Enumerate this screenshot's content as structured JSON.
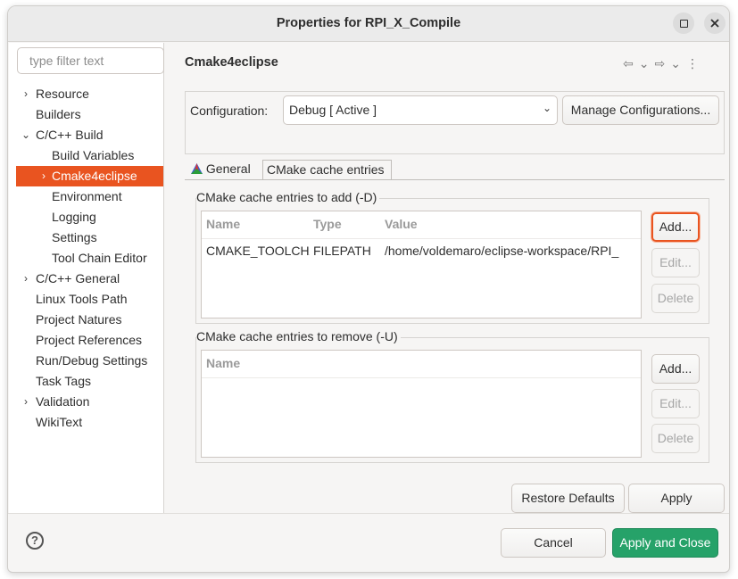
{
  "window": {
    "title": "Properties for RPI_X_Compile"
  },
  "filter": {
    "placeholder": "type filter text"
  },
  "tree": {
    "resource": "Resource",
    "builders": "Builders",
    "cpp_build": "C/C++ Build",
    "build_variables": "Build Variables",
    "cmake4eclipse": "Cmake4eclipse",
    "environment": "Environment",
    "logging": "Logging",
    "settings": "Settings",
    "tool_chain_editor": "Tool Chain Editor",
    "cpp_general": "C/C++ General",
    "linux_tools_path": "Linux Tools Path",
    "project_natures": "Project Natures",
    "project_references": "Project References",
    "run_debug_settings": "Run/Debug Settings",
    "task_tags": "Task Tags",
    "validation": "Validation",
    "wikitext": "WikiText"
  },
  "page": {
    "title": "Cmake4eclipse"
  },
  "configuration": {
    "label": "Configuration:",
    "selected": "Debug  [ Active ]",
    "manage_button": "Manage Configurations..."
  },
  "tabs": {
    "general": "General",
    "cmake_cache": "CMake cache entries"
  },
  "add_group": {
    "title": "CMake cache entries to add (-D)",
    "columns": {
      "name": "Name",
      "type": "Type",
      "value": "Value"
    },
    "rows": [
      {
        "name": "CMAKE_TOOLCHAIN_FILE",
        "type": "FILEPATH",
        "value": "/home/voldemaro/eclipse-workspace/RPI_"
      }
    ],
    "add_button": "Add...",
    "edit_button": "Edit...",
    "delete_button": "Delete"
  },
  "remove_group": {
    "title": "CMake cache entries to remove (-U)",
    "columns": {
      "name": "Name"
    },
    "add_button": "Add...",
    "edit_button": "Edit...",
    "delete_button": "Delete"
  },
  "actions": {
    "restore_defaults": "Restore Defaults",
    "apply": "Apply",
    "cancel": "Cancel",
    "apply_and_close": "Apply and Close"
  },
  "colors": {
    "accent": "#e95420",
    "primary": "#26a269"
  }
}
